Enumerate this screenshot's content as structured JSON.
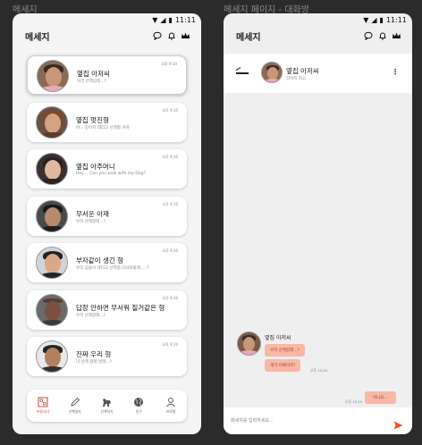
{
  "frames": {
    "list_label": "메세지",
    "chat_label": "메세지 페이지 - 대화방"
  },
  "status": {
    "time": "11:11"
  },
  "list_screen": {
    "title": "메세지",
    "conversations": [
      {
        "name": "옆집 아저씨",
        "preview": "우리 산책갈래...?",
        "time": "오후 9:10",
        "avatar": "man-pink-shirt"
      },
      {
        "name": "옆집 멋진형",
        "preview": "야... 강아지 데리고 산책할 거야",
        "time": "오후 9:10",
        "avatar": "man-beard"
      },
      {
        "name": "옆집 아주머니",
        "preview": "Hey.... Can you walk with my Dog?",
        "time": "오후 9:10",
        "avatar": "woman-curly"
      },
      {
        "name": "무서운 아재",
        "preview": "우리 산책갈래...?",
        "time": "오후 9:10",
        "avatar": "man-dark"
      },
      {
        "name": "부자같이 생긴 형",
        "preview": "우리 곰돌이 데리고 산책좀 다녀와줄래.....?",
        "time": "오후 9:10",
        "avatar": "man-suit"
      },
      {
        "name": "답장 안하면 무서워 질거같은 형",
        "preview": "우리 산책갈래...?",
        "time": "오후 9:10",
        "avatar": "man-bald"
      },
      {
        "name": "진짜 우리 형",
        "preview": "너 산책 갈래 말래...?",
        "time": "오후 9:10",
        "avatar": "man-stubble"
      }
    ],
    "nav": [
      {
        "label": "커뮤니티",
        "icon": "community-icon",
        "active": true
      },
      {
        "label": "산책일지",
        "icon": "pencil-icon",
        "active": false
      },
      {
        "label": "산책하기",
        "icon": "dog-icon",
        "active": false
      },
      {
        "label": "친구",
        "icon": "globe-icon",
        "active": false
      },
      {
        "label": "프로필",
        "icon": "profile-icon",
        "active": false
      }
    ]
  },
  "chat_screen": {
    "title": "메세지",
    "partner_name": "옆집 아저씨",
    "partner_status": "강아지 최고",
    "messages": [
      {
        "from": "옆집 아저씨",
        "text": "우리 산책갈래...?",
        "side": "left"
      },
      {
        "from": "옆집 아저씨",
        "text": "개가 이뻐더라!",
        "side": "left",
        "time": "오후 10:40"
      },
      {
        "from": "me",
        "text": "아니요...",
        "side": "right",
        "time": "오후 10:40"
      }
    ],
    "input_placeholder": "메세지를 입력하세요..."
  },
  "colors": {
    "accent": "#f4511e",
    "bubble": "#f9b7a7",
    "bubble_text": "#b03c2c",
    "active_nav": "#c0392b"
  }
}
